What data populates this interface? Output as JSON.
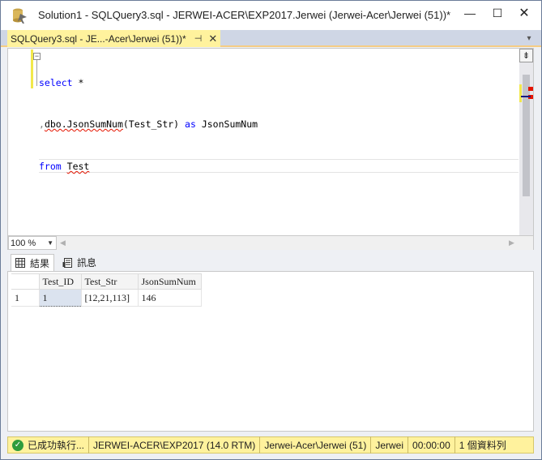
{
  "window": {
    "title": "Solution1 - SQLQuery3.sql - JERWEI-ACER\\EXP2017.Jerwei (Jerwei-Acer\\Jerwei (51))*",
    "minimize_glyph": "—",
    "maximize_glyph": "☐",
    "close_glyph": "✕"
  },
  "document_tab": {
    "label": "SQLQuery3.sql - JE...-Acer\\Jerwei (51))*",
    "pin_glyph": "⊣",
    "close_glyph": "✕"
  },
  "editor": {
    "collapse_glyph": "−",
    "split_glyph": "⇟",
    "lines": [
      {
        "kw1": "select",
        "rest": " *"
      },
      {
        "comma": ",",
        "func": "dbo.JsonSumNum",
        "args": "(Test_Str) ",
        "kw": "as",
        "alias": " JsonSumNum"
      },
      {
        "kw": "from",
        "table": "Test"
      }
    ]
  },
  "zoom": {
    "value": "100 %",
    "options": [
      "100 %"
    ]
  },
  "result_tabs": [
    {
      "label": "結果",
      "icon": "grid-icon"
    },
    {
      "label": "訊息",
      "icon": "messages-icon"
    }
  ],
  "results_grid": {
    "columns": [
      "Test_ID",
      "Test_Str",
      "JsonSumNum"
    ],
    "rows": [
      {
        "row_number": "1",
        "cells": [
          "1",
          "[12,21,113]",
          "146"
        ]
      }
    ]
  },
  "status_bar": {
    "message": "已成功執行...",
    "server": "JERWEI-ACER\\EXP2017 (14.0 RTM)",
    "login": "Jerwei-Acer\\Jerwei (51)",
    "database": "Jerwei",
    "elapsed": "00:00:00",
    "rows": "1 個資料列"
  },
  "colors": {
    "keyword": "#0000ff",
    "identifier": "#000000",
    "operator": "#808080",
    "tab_active": "#fff29d",
    "status_bar": "#fff29d",
    "status_ok": "#2e9c3c",
    "squiggle": "#e51400"
  }
}
